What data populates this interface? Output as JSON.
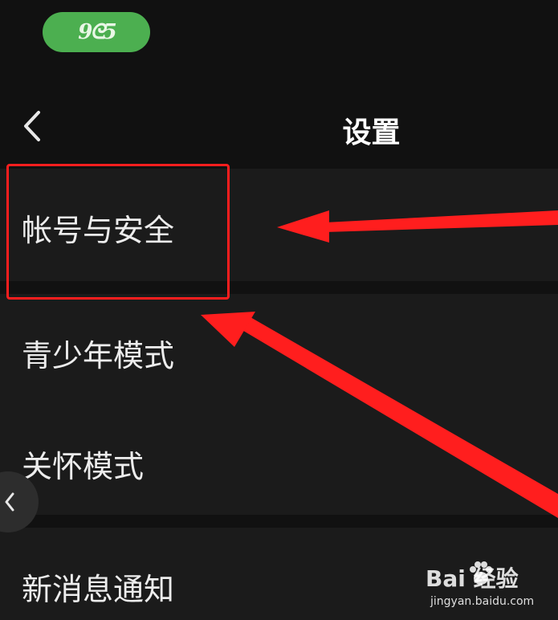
{
  "status_bar": {
    "pill_text": "9ᘓ5",
    "pill_color": "#4caf50"
  },
  "header": {
    "title": "设置",
    "back_icon": "chevron-left-icon"
  },
  "settings": {
    "items": [
      {
        "label": "帐号与安全"
      },
      {
        "label": "青少年模式"
      },
      {
        "label": "关怀模式"
      },
      {
        "label": "新消息通知"
      }
    ]
  },
  "annotation": {
    "highlight_color": "#ff1e1e",
    "target": "帐号与安全"
  },
  "watermark": {
    "brand": "Bai  经验",
    "url": "jingyan.baidu.com"
  },
  "theme": {
    "background": "#111111",
    "item_background": "#1b1b1b"
  }
}
